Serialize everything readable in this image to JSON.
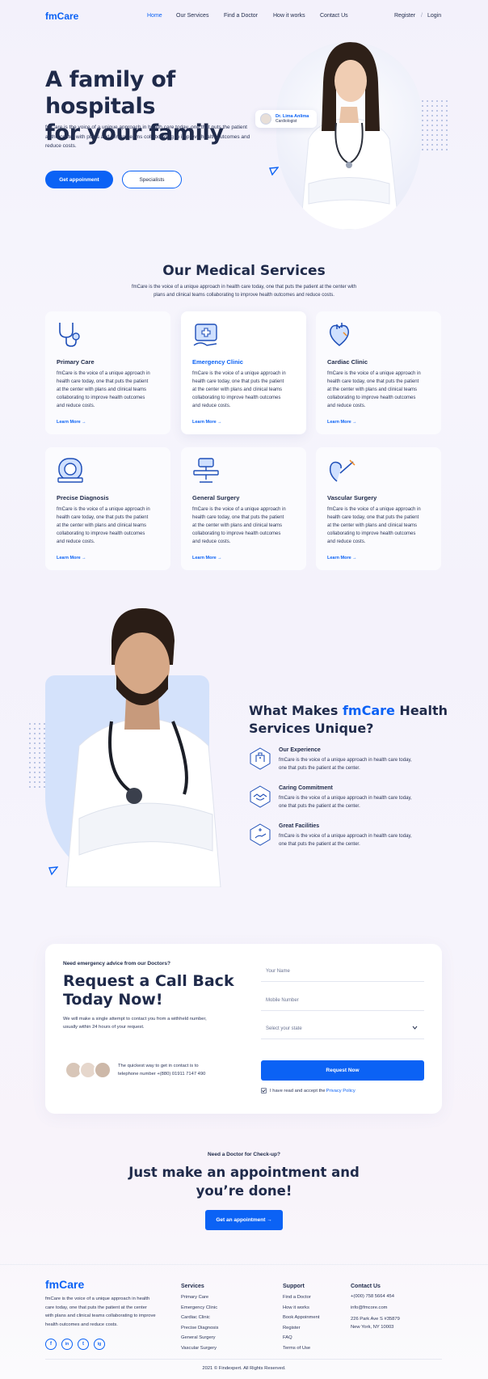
{
  "nav": {
    "logo": "fmCare",
    "links": [
      "Home",
      "Our Services",
      "Find a Doctor",
      "How it works",
      "Contact Us"
    ],
    "register": "Register",
    "separator": "/",
    "login": "Login"
  },
  "hero": {
    "title_line1": "A family of hospitals",
    "title_line2": "for your family",
    "description": "fmCare is the voice of a unique approach in health care today, one that puts the patient at the center with plans and clinical teams collaborating to improve health outcomes and reduce costs.",
    "primary_button": "Get appoinment",
    "secondary_button": "Specialists",
    "doctor_name": "Dr. Lima Anlima",
    "doctor_role": "Cardiologist"
  },
  "services": {
    "title": "Our Medical Services",
    "intro_line1": "fmCare is the voice of a unique approach in health care today, one that puts the patient at the center with",
    "intro_line2": "plans and clinical teams collaborating to improve health outcomes and reduce costs.",
    "learn_more": "Learn More →",
    "items": [
      {
        "title": "Primary Care",
        "icon": "stethoscope-icon",
        "text": [
          "fmCare is the voice of a unique approach in",
          "health care today, one that puts the patient",
          "at the center with plans and clinical teams",
          "collaborating to improve health outcomes",
          "and reduce costs."
        ]
      },
      {
        "title": "Emergency Clinic",
        "icon": "emergency-clinic-icon",
        "text": [
          "fmCare is the voice of a unique approach in",
          "health care today, one that puts the patient",
          "at the center with plans and clinical teams",
          "collaborating to improve health outcomes",
          "and reduce costs."
        ]
      },
      {
        "title": "Cardiac Clinic",
        "icon": "heart-icon",
        "text": [
          "fmCare is the voice of a unique approach in",
          "health care today, one that puts the patient",
          "at the center with plans and clinical teams",
          "collaborating to improve health outcomes",
          "and reduce costs."
        ]
      },
      {
        "title": "Precise Diagnosis",
        "icon": "mri-scanner-icon",
        "text": [
          "fmCare is the voice of a unique approach in",
          "health care today, one that puts the patient",
          "at the center with plans and clinical teams",
          "collaborating to improve health outcomes",
          "and reduce costs."
        ]
      },
      {
        "title": "General Surgery",
        "icon": "surgery-table-icon",
        "text": [
          "fmCare is the voice of a unique approach in",
          "health care today, one that puts the patient",
          "at the center with plans and clinical teams",
          "collaborating to improve health outcomes",
          "and reduce costs."
        ]
      },
      {
        "title": "Vascular Surgery",
        "icon": "vascular-icon",
        "text": [
          "fmCare is the voice of a unique approach in",
          "health care today, one that puts the patient",
          "at the center with plans and clinical teams",
          "collaborating to improve health outcomes",
          "and reduce costs."
        ]
      }
    ]
  },
  "unique": {
    "title_part1": "What Makes ",
    "title_brand": "fmCare",
    "title_part2": " Health",
    "title_line2": "Services Unique?",
    "features": [
      {
        "title": "Our Experience",
        "icon": "hospital-icon",
        "line1": "fmCare is the voice of a unique approach in health care today,",
        "line2": "one that puts the patient at the center."
      },
      {
        "title": "Caring Commitment",
        "icon": "handshake-icon",
        "line1": "fmCare is the voice of a unique approach in health care today,",
        "line2": "one that puts the patient at the center."
      },
      {
        "title": "Great Facilities",
        "icon": "medical-hand-icon",
        "line1": "fmCare is the voice of a unique approach in health care today,",
        "line2": "one that puts the patient at the center."
      }
    ]
  },
  "callback": {
    "eyebrow": "Need emergency advice from our Doctors?",
    "title_line1": "Request a Call Back",
    "title_line2": "Today Now!",
    "desc_line1": "We will make a single attempt to contact you from a withheld number,",
    "desc_line2": "usually within 24 hours of your request.",
    "contact_line1": "The quickest way to get in contact is to",
    "contact_line2": "telephone number +(880) 01911 7147 490",
    "name_placeholder": "Your Name",
    "mobile_placeholder": "Mobile Number",
    "state_placeholder": "Select your state",
    "button": "Request Now",
    "consent_text": "I have read and accept the ",
    "privacy_link": "Privacy Policy"
  },
  "appointment": {
    "eyebrow": "Need a Doctor for Check-up?",
    "title_line1": "Just make an appointment and",
    "title_line2": "you’re done!",
    "button": "Get an appointment →"
  },
  "footer": {
    "logo": "fmCare",
    "about": [
      "fmCare is the voice of a unique approach in health",
      "care today, one that puts the patient at the center",
      "with plans and clinical teams collaborating to improve",
      "health outcomes and reduce costs."
    ],
    "social": [
      "f",
      "in",
      "t",
      "ig"
    ],
    "services_head": "Services",
    "services": [
      "Primary Care",
      "Emergency Clinic",
      "Cardiac Clinic",
      "Precise Diagnosis",
      "General Surgery",
      "Vascular Surgery"
    ],
    "support_head": "Support",
    "support": [
      "Find a Doctor",
      "How it works",
      "Book Appoinment",
      "Register",
      "FAQ",
      "Terms of Use"
    ],
    "contact_head": "Contact Us",
    "contact": [
      "+(000) 758 5664 454",
      "info@fmcore.com",
      "226 Park Ave S #35879",
      "New York, NY 10003"
    ],
    "copyright": "2021 © Findexpert. All Rights Reserved."
  },
  "colors": {
    "accent": "#0b62f5",
    "text": "#1f2a4a"
  }
}
